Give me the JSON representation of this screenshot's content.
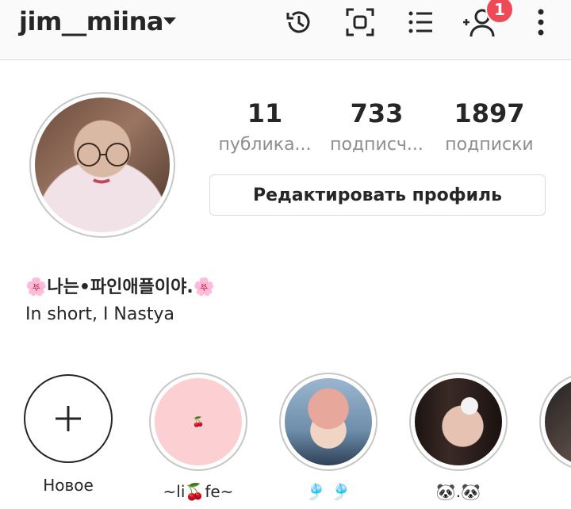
{
  "header": {
    "username": "jim__miina",
    "icons": [
      "history-icon",
      "scan-icon",
      "list-star-icon",
      "add-user-icon",
      "more-icon"
    ],
    "notification_count": "1",
    "accent": "#ed4956"
  },
  "profile": {
    "stats": [
      {
        "value": "11",
        "label": "публика..."
      },
      {
        "value": "733",
        "label": "подписч..."
      },
      {
        "value": "1897",
        "label": "подписки"
      }
    ],
    "edit_label": "Редактировать профиль",
    "bio_name": "🌸나는•파인애플이야.🌸",
    "bio_text": "In short, I Nastya"
  },
  "highlights": [
    {
      "label": "Новое"
    },
    {
      "label": "~li🍒fe~",
      "cover": "🍒"
    },
    {
      "label": "🎐 🎐"
    },
    {
      "label": "🐼.🐼"
    },
    {
      "label": "~"
    }
  ]
}
